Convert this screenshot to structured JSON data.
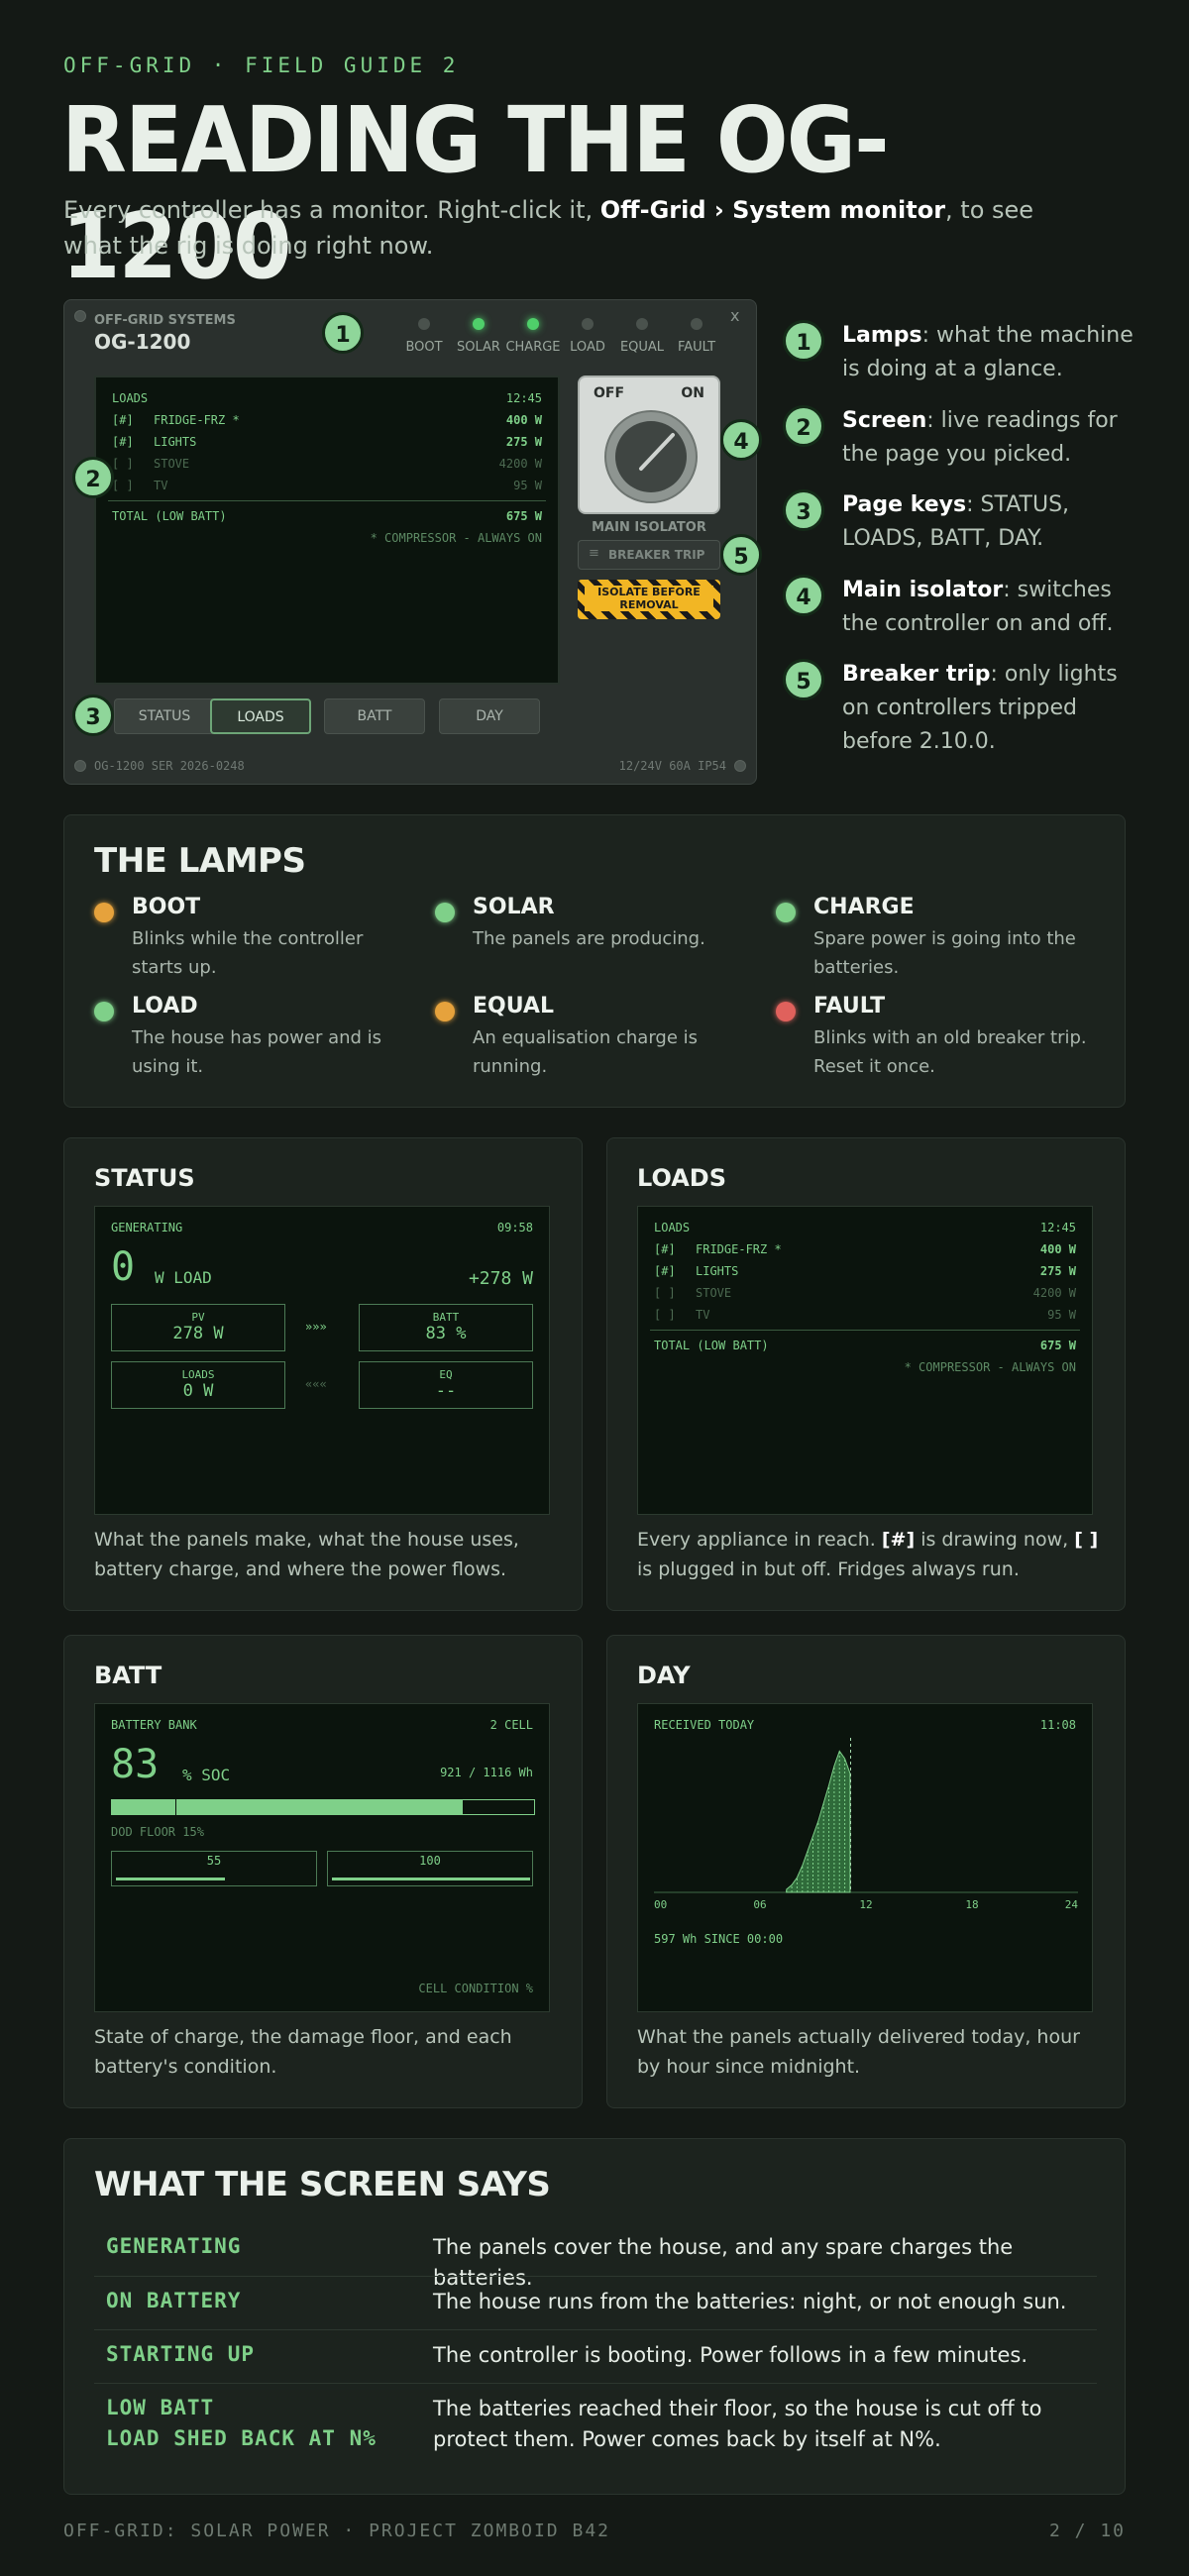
{
  "kicker": "OFF-GRID · FIELD GUIDE 2",
  "title": "READING THE OG-1200",
  "intro": {
    "pre": "Every controller has a monitor. Right-click it,",
    "menu_path": "Off-Grid › System monitor",
    "post": ", to see what the rig is doing right now."
  },
  "device": {
    "brand": "OFF-GRID SYSTEMS",
    "model": "OG-1200",
    "close": "x",
    "lamps": [
      "BOOT",
      "SOLAR",
      "CHARGE",
      "LOAD",
      "EQUAL",
      "FAULT"
    ],
    "screen": {
      "page": "LOADS",
      "time": "12:45",
      "rows": [
        {
          "flag": "[#]",
          "name": "FRIDGE-FRZ *",
          "watts": "400 W"
        },
        {
          "flag": "[#]",
          "name": "LIGHTS",
          "watts": "275 W"
        },
        {
          "flag": "[ ]",
          "name": "STOVE",
          "watts": "4200 W"
        },
        {
          "flag": "[ ]",
          "name": "TV",
          "watts": "95 W"
        }
      ],
      "total_label": "TOTAL (LOW BATT)",
      "total_value": "675 W",
      "note": "* COMPRESSOR - ALWAYS ON"
    },
    "dial_off": "OFF",
    "dial_on": "ON",
    "isolator_label": "MAIN ISOLATOR",
    "breaker_label": "BREAKER TRIP",
    "warning": "ISOLATE BEFORE REMOVAL",
    "keys": [
      "STATUS",
      "LOADS",
      "BATT",
      "DAY"
    ],
    "footer_left": "OG-1200  SER 2026-0248",
    "footer_right": "12/24V  60A  IP54",
    "badges": [
      "1",
      "2",
      "3",
      "4",
      "5"
    ]
  },
  "callouts": [
    {
      "n": "1",
      "title": "Lamps",
      "text": ": what the machine is doing at a glance."
    },
    {
      "n": "2",
      "title": "Screen",
      "text": ": live readings for the page you picked."
    },
    {
      "n": "3",
      "title": "Page keys",
      "text": ": STATUS, LOADS, BATT, DAY."
    },
    {
      "n": "4",
      "title": "Main isolator",
      "text": ": switches the controller on and off."
    },
    {
      "n": "5",
      "title": "Breaker trip",
      "text": ": only lights on controllers tripped before 2.10.0."
    }
  ],
  "lamps_section": {
    "heading": "THE LAMPS",
    "items": [
      {
        "name": "BOOT",
        "color": "#e6a23c",
        "desc": "Blinks while the controller starts up."
      },
      {
        "name": "SOLAR",
        "color": "#7fd089",
        "desc": "The panels are producing."
      },
      {
        "name": "CHARGE",
        "color": "#7fd089",
        "desc": "Spare power is going into the batteries."
      },
      {
        "name": "LOAD",
        "color": "#7fd089",
        "desc": "The house has power and is using it."
      },
      {
        "name": "EQUAL",
        "color": "#e6a23c",
        "desc": "An equalisation charge is running."
      },
      {
        "name": "FAULT",
        "color": "#e0615c",
        "desc": "Blinks with an old breaker trip. Reset it once."
      }
    ]
  },
  "status_pane": {
    "heading": "STATUS",
    "state": "GENERATING",
    "time": "09:58",
    "big": "0",
    "big_unit": "W LOAD",
    "net": "+278 W",
    "pv_label": "PV",
    "pv_value": "278 W",
    "batt_label": "BATT",
    "batt_value": "83 %",
    "loads_label": "LOADS",
    "loads_value": "0 W",
    "eq_label": "EQ",
    "eq_value": "--",
    "arrow_on": "»»»",
    "arrow_off": "«««",
    "desc": "What the panels make, what the house uses, battery charge, and where the power flows."
  },
  "loads_pane": {
    "heading": "LOADS",
    "desc_pre": "Every appliance in reach. ",
    "desc_on": "[#]",
    "desc_mid": " is drawing now, ",
    "desc_off": "[ ]",
    "desc_post": " is plugged in but off. Fridges always run."
  },
  "batt_pane": {
    "heading": "BATT",
    "title": "BATTERY BANK",
    "cells": "2 CELL",
    "soc": "83",
    "soc_unit": "% SOC",
    "wh": "921 / 1116 Wh",
    "soc_fraction": 0.83,
    "floor_fraction": 0.15,
    "floor_label": "DOD FLOOR 15%",
    "cell_values": [
      "55",
      "100"
    ],
    "cell_fractions": [
      0.55,
      1.0
    ],
    "condition": "CELL CONDITION %",
    "desc": "State of charge, the damage floor, and each battery's condition."
  },
  "day_pane": {
    "heading": "DAY",
    "title": "RECEIVED TODAY",
    "time": "11:08",
    "ticks": [
      "00",
      "06",
      "12",
      "18",
      "24"
    ],
    "summary": "597 Wh SINCE 00:00",
    "desc": "What the panels actually delivered today, hour by hour since midnight."
  },
  "chart_data": {
    "type": "area",
    "title": "RECEIVED TODAY",
    "xlabel": "",
    "ylabel": "",
    "xlim": [
      0,
      24
    ],
    "x_ticks": [
      "00",
      "06",
      "12",
      "18",
      "24"
    ],
    "x": [
      7.5,
      7.8,
      8.1,
      8.4,
      8.7,
      9.0,
      9.3,
      9.6,
      9.9,
      10.2,
      10.5,
      10.8,
      11.1
    ],
    "values": [
      0.02,
      0.05,
      0.1,
      0.18,
      0.28,
      0.38,
      0.48,
      0.6,
      0.72,
      0.85,
      0.95,
      0.9,
      0.8
    ],
    "current_time_x": 11.13
  },
  "screen_says": {
    "heading": "WHAT THE SCREEN SAYS",
    "rows": [
      {
        "key": "GENERATING",
        "val": "The panels cover the house, and any spare charges the batteries."
      },
      {
        "key": "ON BATTERY",
        "val": "The house runs from the batteries: night, or not enough sun."
      },
      {
        "key": "STARTING UP",
        "val": "The controller is booting. Power follows in a few minutes."
      },
      {
        "key": "LOW BATT",
        "key2": "LOAD SHED BACK AT N%",
        "val": "The batteries reached their floor, so the house is cut off to protect them. Power comes back by itself at N%."
      }
    ]
  },
  "footer": {
    "left": "OFF-GRID: SOLAR POWER · PROJECT ZOMBOID B42",
    "right": "2 / 10"
  }
}
